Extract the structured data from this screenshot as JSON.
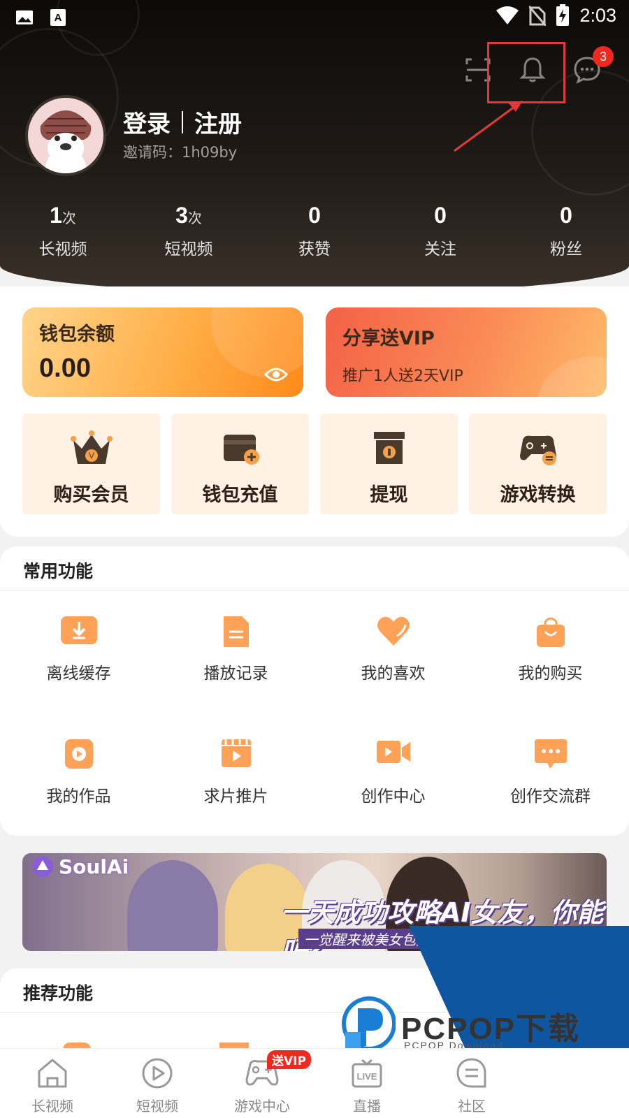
{
  "status_bar": {
    "time": "2:03"
  },
  "header": {
    "login_label": "登录",
    "register_label": "注册",
    "invite_text": "邀请码：1h09by",
    "message_badge": "3"
  },
  "stats": [
    {
      "value": "1",
      "unit": "次",
      "label": "长视频"
    },
    {
      "value": "3",
      "unit": "次",
      "label": "短视频"
    },
    {
      "value": "0",
      "unit": "",
      "label": "获赞"
    },
    {
      "value": "0",
      "unit": "",
      "label": "关注"
    },
    {
      "value": "0",
      "unit": "",
      "label": "粉丝"
    }
  ],
  "wallet": {
    "title": "钱包余额",
    "amount": "0.00"
  },
  "share": {
    "title": "分享送VIP",
    "subtitle": "推广1人送2天VIP"
  },
  "tiles": [
    {
      "label": "购买会员",
      "icon": "crown-icon"
    },
    {
      "label": "钱包充值",
      "icon": "wallet-add-icon"
    },
    {
      "label": "提现",
      "icon": "withdraw-box-icon"
    },
    {
      "label": "游戏转换",
      "icon": "gamepad-exchange-icon"
    }
  ],
  "common": {
    "title": "常用功能",
    "items": [
      {
        "label": "离线缓存",
        "icon": "download-icon"
      },
      {
        "label": "播放记录",
        "icon": "document-icon"
      },
      {
        "label": "我的喜欢",
        "icon": "heart-icon"
      },
      {
        "label": "我的购买",
        "icon": "shopping-bag-icon"
      },
      {
        "label": "我的作品",
        "icon": "play-square-icon"
      },
      {
        "label": "求片推片",
        "icon": "clapperboard-icon"
      },
      {
        "label": "创作中心",
        "icon": "video-camera-icon"
      },
      {
        "label": "创作交流群",
        "icon": "chat-bubble-icon"
      }
    ]
  },
  "banner": {
    "brand": "SoulAi",
    "headline": "一天成功攻略AI女友，你能吗?",
    "subline": "一觉醒来被美女包围"
  },
  "recommend": {
    "title": "推荐功能"
  },
  "watermark": {
    "brand": "PCPOP下载",
    "sub": "PCPOP Download"
  },
  "tabbar": [
    {
      "label": "长视频",
      "icon": "home-icon"
    },
    {
      "label": "短视频",
      "icon": "play-circle-icon"
    },
    {
      "label": "游戏中心",
      "icon": "gamepad-icon",
      "badge": "送VIP"
    },
    {
      "label": "直播",
      "icon": "live-tv-icon"
    },
    {
      "label": "社区",
      "icon": "community-chat-icon"
    }
  ],
  "colors": {
    "accent": "#ffa258",
    "badge_red": "#f0281e",
    "highlight_box": "#e23a3a"
  }
}
